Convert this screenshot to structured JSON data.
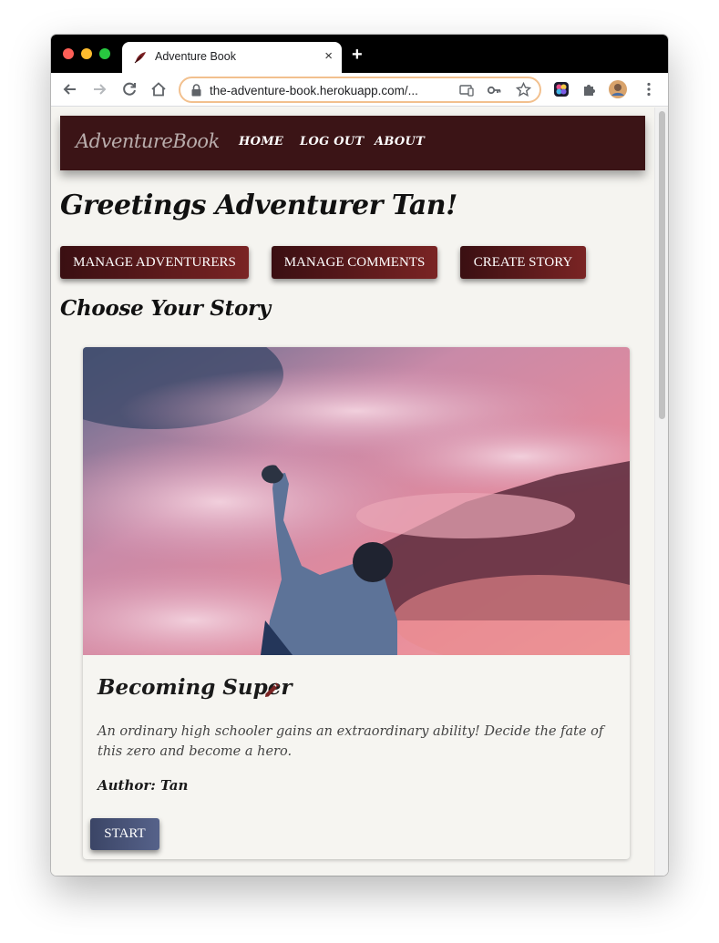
{
  "browser": {
    "tab_title": "Adventure Book",
    "tab_close": "×",
    "new_tab": "+",
    "url": "the-adventure-book.herokuapp.com/..."
  },
  "site": {
    "logo": "AdventureBook",
    "nav": [
      {
        "label": "HOME"
      },
      {
        "label": "LOG OUT"
      },
      {
        "label": "ABOUT"
      }
    ]
  },
  "main": {
    "greeting": "Greetings Adventurer Tan!",
    "buttons": {
      "manage_adventurers": "MANAGE ADVENTURERS",
      "manage_comments": "MANAGE COMMENTS",
      "create_story": "CREATE STORY"
    },
    "section_title": "Choose Your Story"
  },
  "story": {
    "title": "Becoming Super",
    "description": "An ordinary high schooler gains an extraordinary ability! Decide the fate of this zero and become a hero.",
    "author": "Author: Tan",
    "start_label": "START"
  },
  "colors": {
    "nav_bg": "#3b1416",
    "button_dark_start": "#3a0f12",
    "button_dark_end": "#7a2424",
    "start_button": "#4a5578",
    "pencil": "#7a2424"
  },
  "icons": [
    "back-arrow-icon",
    "forward-arrow-icon",
    "reload-icon",
    "home-icon",
    "lock-icon",
    "cast-icon",
    "key-icon",
    "star-icon",
    "extension-icon",
    "puzzle-icon",
    "profile-avatar",
    "more-menu-icon",
    "pencil-icon"
  ]
}
